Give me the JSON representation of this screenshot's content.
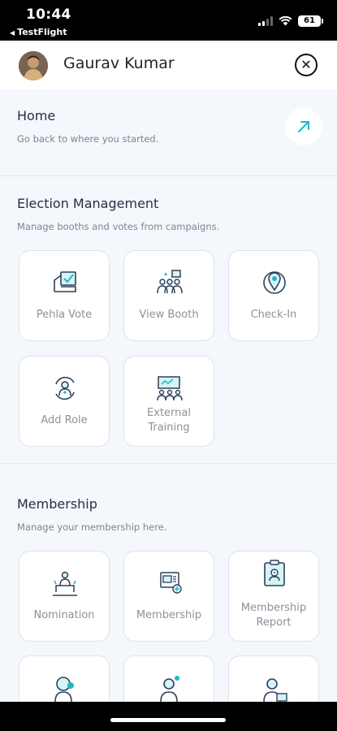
{
  "status_bar": {
    "time": "10:44",
    "back_app": "TestFlight",
    "battery": "61"
  },
  "header": {
    "user_name": "Gaurav Kumar",
    "close_icon": "close-icon"
  },
  "home": {
    "title": "Home",
    "subtitle": "Go back to where you started.",
    "icon": "arrow-up-right-icon"
  },
  "election": {
    "title": "Election Management",
    "subtitle": "Manage booths and votes from campaigns.",
    "tiles": [
      {
        "label": "Pehla Vote",
        "icon": "ballot-icon"
      },
      {
        "label": "View Booth",
        "icon": "booth-icon"
      },
      {
        "label": "Check-In",
        "icon": "location-pin-icon"
      },
      {
        "label": "Add Role",
        "icon": "role-icon"
      },
      {
        "label": "External Training",
        "icon": "training-icon"
      }
    ]
  },
  "membership": {
    "title": "Membership",
    "subtitle": "Manage your membership here.",
    "tiles": [
      {
        "label": "Nomination",
        "icon": "nomination-icon"
      },
      {
        "label": "Membership",
        "icon": "membership-icon"
      },
      {
        "label": "Membership Report",
        "icon": "report-icon"
      }
    ]
  },
  "colors": {
    "accent": "#22b6c9",
    "icon_stroke": "#2d4059",
    "tile_border": "#dde3eb",
    "page_bg": "#f4f7fb"
  }
}
